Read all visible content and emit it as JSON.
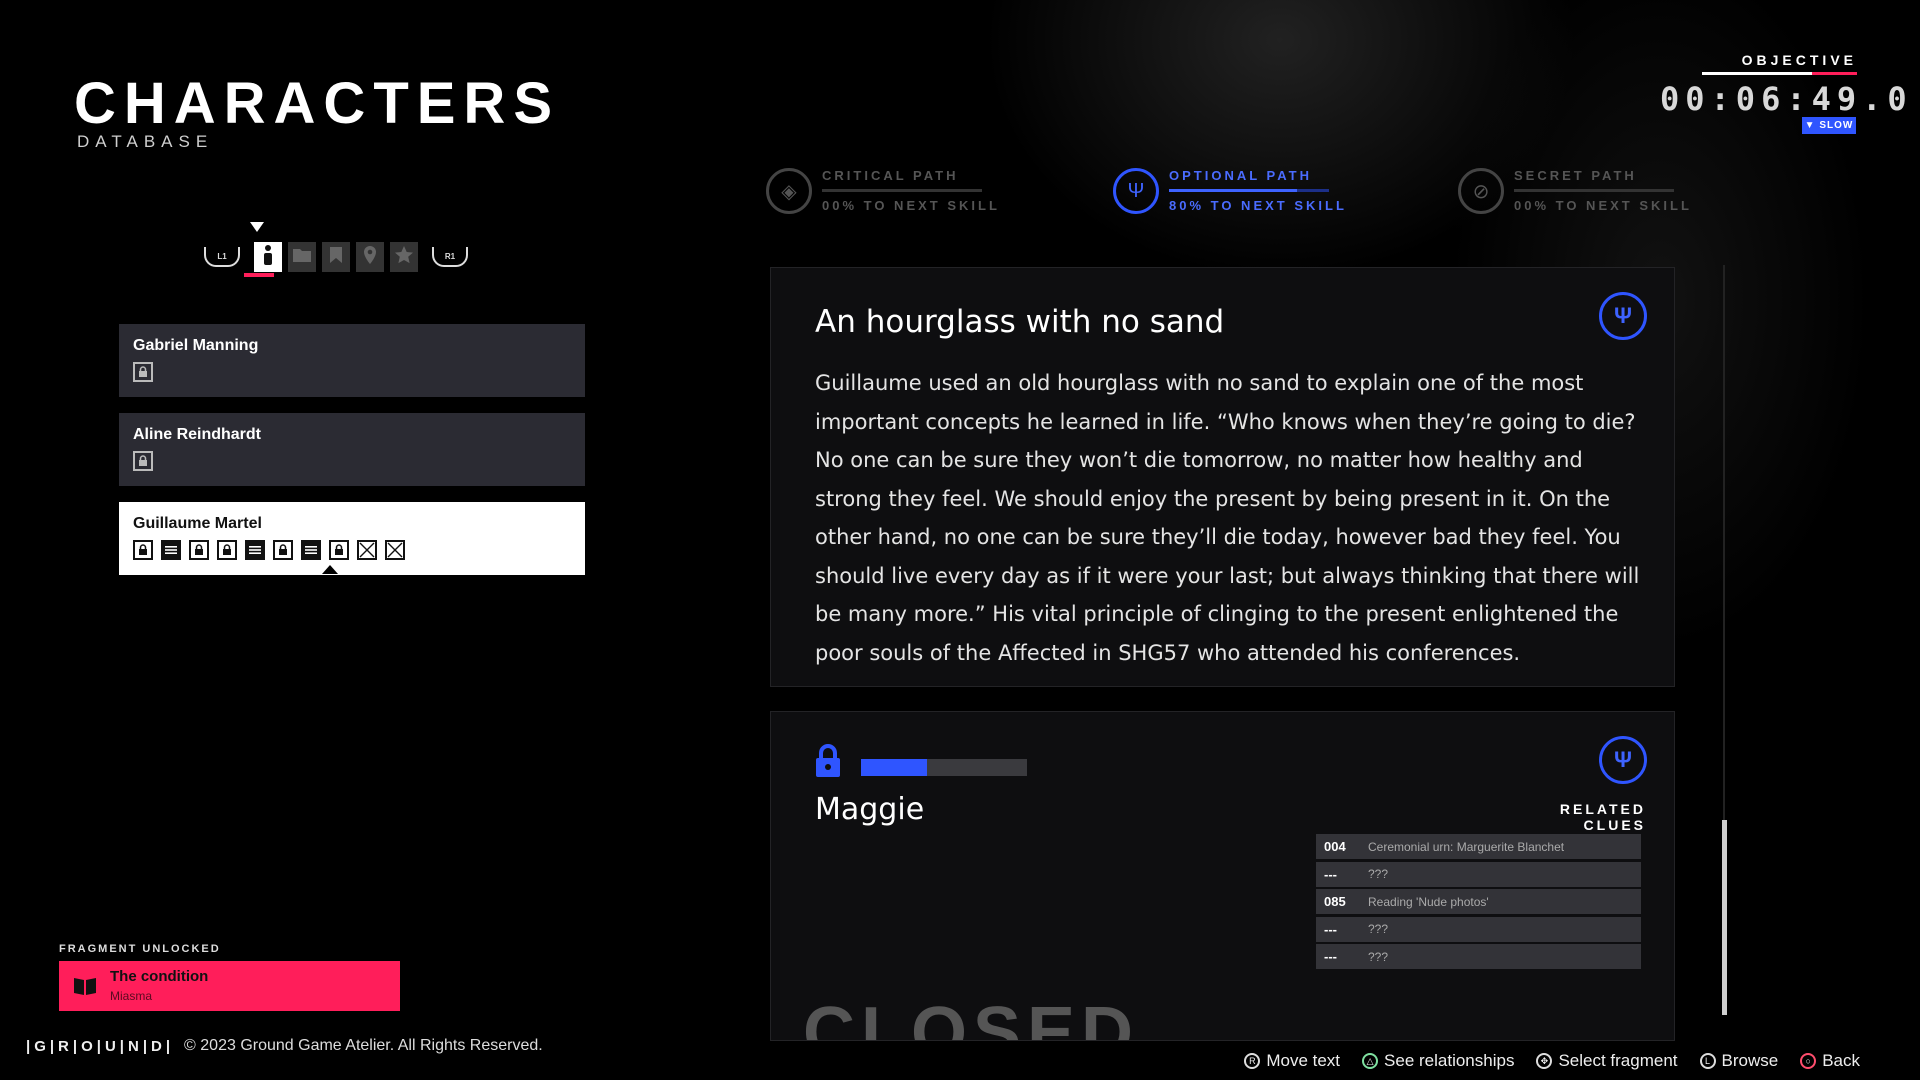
{
  "header": {
    "title": "CHARACTERS",
    "subtitle": "DATABASE"
  },
  "tabs": {
    "left_shoulder": "L1",
    "right_shoulder": "R1",
    "items": [
      {
        "icon": "person-icon",
        "active": true
      },
      {
        "icon": "folder-icon",
        "active": false
      },
      {
        "icon": "bookmark-icon",
        "active": false
      },
      {
        "icon": "location-pin-icon",
        "active": false
      },
      {
        "icon": "star-icon",
        "active": false
      }
    ]
  },
  "characters": [
    {
      "name": "Gabriel Manning",
      "fragments": [
        "lock"
      ]
    },
    {
      "name": "Aline Reindhardt",
      "fragments": [
        "lock"
      ]
    },
    {
      "name": "Guillaume Martel",
      "fragments": [
        "lock",
        "doc",
        "lock",
        "lock",
        "doc",
        "lock",
        "doc",
        "lock",
        "crossed",
        "crossed"
      ]
    }
  ],
  "objective": {
    "label": "OBJECTIVE",
    "timer": "00:06:49.0",
    "speed": "▼ SLOW"
  },
  "paths": [
    {
      "label": "CRITICAL PATH",
      "progress_text": "00% TO NEXT SKILL",
      "progress": 0.0
    },
    {
      "label": "OPTIONAL PATH",
      "progress_text": "80% TO NEXT SKILL",
      "progress": 0.8
    },
    {
      "label": "SECRET PATH",
      "progress_text": "00% TO NEXT SKILL",
      "progress": 0.0
    }
  ],
  "fragment_card": {
    "title": "An hourglass with no sand",
    "body": "Guillaume used an old hourglass with no sand to explain one of the most important concepts he learned in life. “Who knows when they’re going to die? No one can be sure they won’t die tomorrow, no matter how healthy and strong they feel. We should enjoy the present by being present in it. On the other hand, no one can be sure they’ll die today, however bad they feel. You should live every day as if it were your last; but always thinking that there will be many more.” His vital principle of clinging to the present enlightened the poor souls of the Affected in SHG57 who attended his conferences."
  },
  "next_card": {
    "name": "Maggie",
    "progress": 0.4,
    "related_label": "RELATED CLUES",
    "clues": [
      {
        "num": "004",
        "text": "Ceremonial urn: Marguerite Blanchet"
      },
      {
        "num": "---",
        "text": "???"
      },
      {
        "num": "085",
        "text": "Reading 'Nude photos'"
      },
      {
        "num": "---",
        "text": "???"
      },
      {
        "num": "---",
        "text": "???"
      }
    ],
    "stamp": "CLOSED"
  },
  "toast": {
    "label": "FRAGMENT UNLOCKED",
    "title": "The condition",
    "subtitle": "Miasma"
  },
  "footer": {
    "logo": "|G|R|O|U|N|D|",
    "copyright": "© 2023 Ground Game Atelier. All Rights Reserved.",
    "prompts": [
      {
        "label": "Move text",
        "button": "R"
      },
      {
        "label": "See relationships",
        "button": "△"
      },
      {
        "label": "Select fragment",
        "button": "✥"
      },
      {
        "label": "Browse",
        "button": "L"
      },
      {
        "label": "Back",
        "button": "○"
      }
    ]
  },
  "colors": {
    "accent_blue": "#2f55ff",
    "accent_pink": "#ff1e5a"
  }
}
